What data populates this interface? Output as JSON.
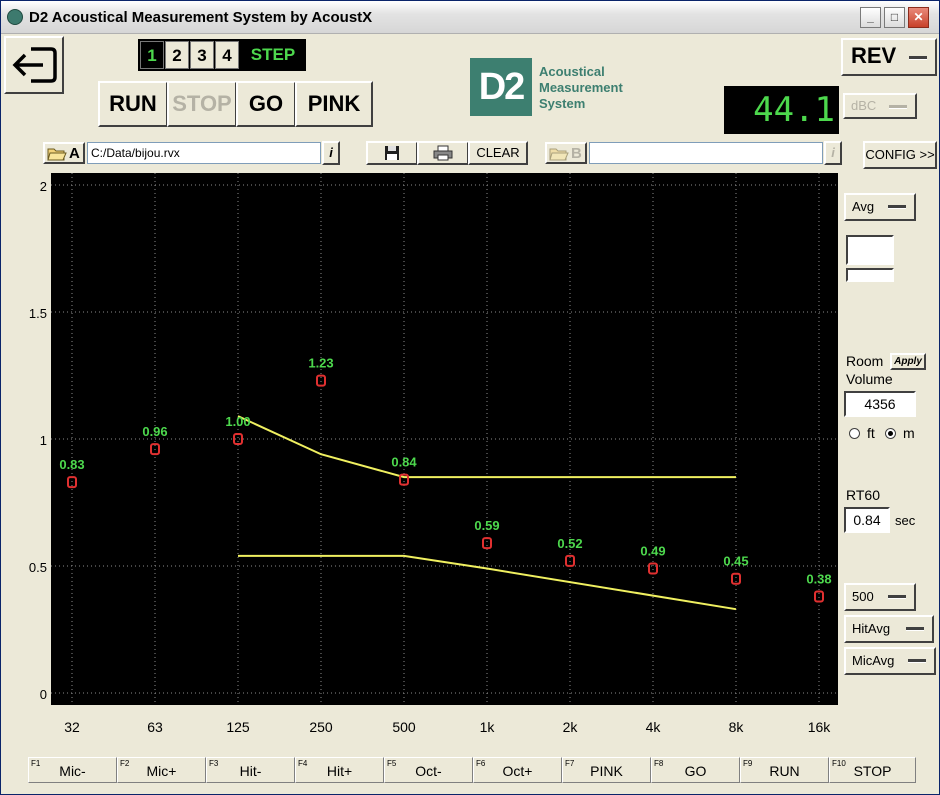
{
  "window": {
    "title": "D2 Acoustical Measurement System by AcoustX"
  },
  "toolbar": {
    "step_buttons": [
      "1",
      "2",
      "3",
      "4"
    ],
    "step_label": "STEP",
    "run": "RUN",
    "stop": "STOP",
    "go": "GO",
    "pink": "PINK",
    "rev": "REV",
    "config": "CONFIG >>",
    "clear": "CLEAR"
  },
  "logo": {
    "mark": "D2",
    "line1": "Acoustical",
    "line2": "Measurement",
    "line3": "System"
  },
  "meter": {
    "value": "44.1",
    "unit_dropdown": "dBC"
  },
  "file_a": {
    "label": "A",
    "path": "C:/Data/bijou.rvx",
    "info": "i"
  },
  "file_b": {
    "label": "B",
    "path": "",
    "info": "i"
  },
  "side": {
    "avg": "Avg",
    "room_label": "Room",
    "volume_label": "Volume",
    "apply": "Apply",
    "volume_value": "4356",
    "unit_ft": "ft",
    "unit_m": "m",
    "selected_unit": "m",
    "rt60_label": "RT60",
    "rt60_value": "0.84",
    "rt60_unit": "sec",
    "band_dropdown": "500",
    "hitavg": "HitAvg",
    "micavg": "MicAvg"
  },
  "colors": {
    "plot_bg": "#000000",
    "marker": "#e03030",
    "value_label": "#4dd84d",
    "limit_line": "#f0f060"
  },
  "chart_data": {
    "type": "scatter",
    "categories": [
      "32",
      "63",
      "125",
      "250",
      "500",
      "1k",
      "2k",
      "4k",
      "8k",
      "16k"
    ],
    "values": [
      0.83,
      0.96,
      1.0,
      1.23,
      0.84,
      0.59,
      0.52,
      0.49,
      0.45,
      0.38
    ],
    "labels": [
      "0.83",
      "0.96",
      "1.00",
      "1.23",
      "0.84",
      "0.59",
      "0.52",
      "0.49",
      "0.45",
      "0.38"
    ],
    "ylim": [
      0,
      2
    ],
    "yticks": [
      "0",
      "0.5",
      "1",
      "1.5",
      "2"
    ],
    "yticks_values": [
      0,
      0.5,
      1,
      1.5,
      2
    ],
    "upper_limit": [
      {
        "x": 2,
        "y": 1.09
      },
      {
        "x": 3,
        "y": 0.94
      },
      {
        "x": 4,
        "y": 0.85
      },
      {
        "x": 8,
        "y": 0.85
      }
    ],
    "lower_limit": [
      {
        "x": 2,
        "y": 0.54
      },
      {
        "x": 4,
        "y": 0.54
      },
      {
        "x": 5,
        "y": 0.49
      },
      {
        "x": 8,
        "y": 0.33
      }
    ],
    "grid": true
  },
  "fkeys": [
    {
      "num": "F1",
      "label": "Mic-"
    },
    {
      "num": "F2",
      "label": "Mic+"
    },
    {
      "num": "F3",
      "label": "Hit-"
    },
    {
      "num": "F4",
      "label": "Hit+"
    },
    {
      "num": "F5",
      "label": "Oct-"
    },
    {
      "num": "F6",
      "label": "Oct+"
    },
    {
      "num": "F7",
      "label": "PINK"
    },
    {
      "num": "F8",
      "label": "GO"
    },
    {
      "num": "F9",
      "label": "RUN"
    },
    {
      "num": "F10",
      "label": "STOP"
    }
  ]
}
